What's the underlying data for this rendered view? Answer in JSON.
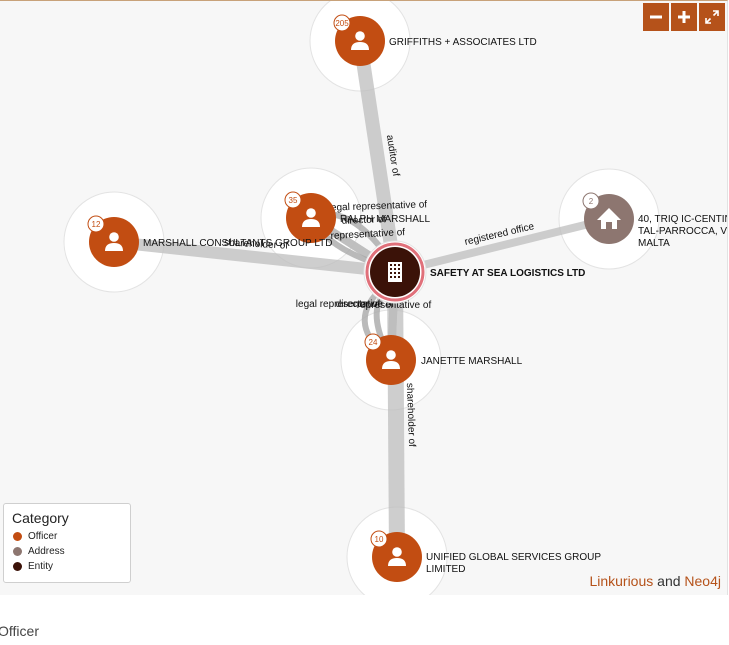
{
  "colors": {
    "officer": "#c24d12",
    "address": "#8d7670",
    "entity": "#3b1208",
    "edge": "#bdbdbd",
    "accent": "#b5521a"
  },
  "controls": {
    "zoom_out_icon": "minus-icon",
    "zoom_in_icon": "plus-icon",
    "fullscreen_icon": "expand-icon"
  },
  "nodes": [
    {
      "id": "n_griffiths",
      "type": "officer",
      "label": [
        "GRIFFITHS + ASSOCIATES LTD"
      ],
      "badge": "205",
      "icon": "person-icon"
    },
    {
      "id": "n_ralph",
      "type": "officer",
      "label": [
        "RALPH MARSHALL"
      ],
      "badge": "35",
      "icon": "person-icon"
    },
    {
      "id": "n_consultants",
      "type": "officer",
      "label": [
        "MARSHALL CONSULTANTS GROUP LTD"
      ],
      "badge": "12",
      "icon": "person-icon"
    },
    {
      "id": "n_address",
      "type": "address",
      "label": [
        "40, TRIQ IC-CENTIN,",
        "TAL-PARROCCA, V",
        "MALTA"
      ],
      "badge": "2",
      "icon": "home-icon"
    },
    {
      "id": "n_safety",
      "type": "entity",
      "label": [
        "SAFETY AT SEA LOGISTICS LTD"
      ],
      "badge": "",
      "icon": "building-icon"
    },
    {
      "id": "n_janette",
      "type": "officer",
      "label": [
        "JANETTE MARSHALL"
      ],
      "badge": "24",
      "icon": "person-icon"
    },
    {
      "id": "n_unified",
      "type": "officer",
      "label": [
        "UNIFIED GLOBAL SERVICES GROUP",
        "LIMITED"
      ],
      "badge": "10",
      "icon": "person-icon"
    }
  ],
  "edges": [
    {
      "source": "n_griffiths",
      "target": "n_safety",
      "label": "auditor of"
    },
    {
      "source": "n_ralph",
      "target": "n_safety",
      "label": "legal representative of"
    },
    {
      "source": "n_ralph",
      "target": "n_safety",
      "label": "director of"
    },
    {
      "source": "n_ralph",
      "target": "n_safety",
      "label": "representative of"
    },
    {
      "source": "n_consultants",
      "target": "n_safety",
      "label": "shareholder of"
    },
    {
      "source": "n_address",
      "target": "n_safety",
      "label": "registered office"
    },
    {
      "source": "n_janette",
      "target": "n_safety",
      "label": "legal representative of"
    },
    {
      "source": "n_janette",
      "target": "n_safety",
      "label": "director of"
    },
    {
      "source": "n_janette",
      "target": "n_safety",
      "label": "representative of"
    },
    {
      "source": "n_unified",
      "target": "n_safety",
      "label": "shareholder of"
    }
  ],
  "legend": {
    "title": "Category",
    "items": [
      {
        "label": "Officer",
        "color": "#c24d12"
      },
      {
        "label": "Address",
        "color": "#8d7670"
      },
      {
        "label": "Entity",
        "color": "#3b1208"
      }
    ]
  },
  "credits": {
    "linkurious": "Linkurious",
    "and": "and",
    "neo4j": "Neo4j"
  },
  "footer": {
    "label": "Officer"
  }
}
